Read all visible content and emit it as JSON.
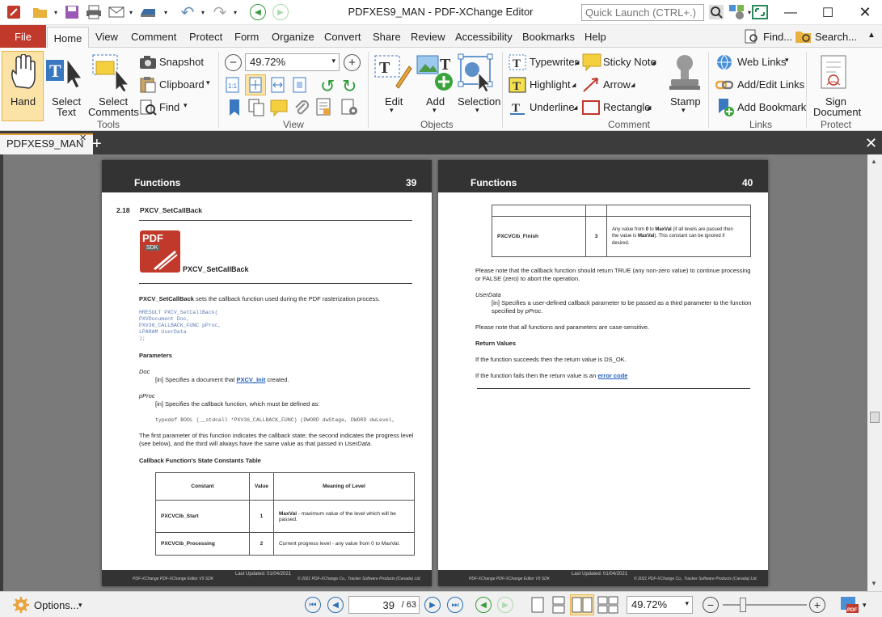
{
  "app": {
    "title": "PDFXES9_MAN - PDF-XChange Editor",
    "quick_launch_placeholder": "Quick Launch (CTRL+.)"
  },
  "menu": {
    "file": "File",
    "tabs": [
      "Home",
      "View",
      "Comment",
      "Protect",
      "Form",
      "Organize",
      "Convert",
      "Share",
      "Review",
      "Accessibility",
      "Bookmarks",
      "Help"
    ],
    "find": "Find...",
    "search": "Search..."
  },
  "ribbon": {
    "tools": {
      "hand": "Hand",
      "select_text": [
        "Select",
        "Text"
      ],
      "select_comments": [
        "Select",
        "Comments"
      ],
      "snapshot": "Snapshot",
      "clipboard": "Clipboard",
      "find": "Find",
      "group": "Tools"
    },
    "view": {
      "zoom": "49.72%",
      "group": "View"
    },
    "objects": {
      "edit": "Edit",
      "add": "Add",
      "selection": "Selection",
      "group": "Objects"
    },
    "comment": {
      "typewriter": "Typewriter",
      "sticky_note": "Sticky Note",
      "highlight": "Highlight",
      "arrow": "Arrow",
      "underline": "Underline",
      "rectangle": "Rectangle",
      "stamp": "Stamp",
      "group": "Comment"
    },
    "links": {
      "web_links": "Web Links",
      "add_edit_links": "Add/Edit Links",
      "add_bookmark": "Add Bookmark",
      "group": "Links"
    },
    "protect": {
      "sign_document": [
        "Sign",
        "Document"
      ],
      "group": "Protect"
    }
  },
  "doc_tab": {
    "name": "PDFXES9_MAN"
  },
  "page39": {
    "header": "Functions",
    "number": "39",
    "section": "2.18",
    "section_title": "PXCV_SetCallBack",
    "logo_text": "PDF",
    "logo_sub": "SDK",
    "heading": "PXCV_SetCallBack",
    "intro_bold": "PXCV_SetCallBack",
    "intro_rest": " sets the callback function used during the PDF rasterization process.",
    "code": [
      "HRESULT  PXCV_SetCallBack(",
      "     PXVDocument Doc,",
      "     PXV36_CALLBACK_FUNC pProc,",
      "     LPARAM UserData",
      ");"
    ],
    "params_heading": "Parameters",
    "p1_name": "Doc",
    "p1_desc_a": "[in] Specifies a document that ",
    "p1_link": "PXCV_Init",
    "p1_desc_b": " created.",
    "p2_name": "pProc",
    "p2_desc": "[in] Specifies the callback function, which must be defined as:",
    "typedef": "typedef BOOL (__stdcall *PXV36_CALLBACK_FUNC) (DWORD dwStage, DWORD dwLevel,",
    "para1": "The first parameter of this function indicates the callback state; the second indicates the progress level",
    "para2a": "(see below), and the third will always have the same value as that passed in ",
    "para2b": "UserData",
    "para2c": ".",
    "table_title": "Callback Function's State Constants Table",
    "table_headers": [
      "Constant",
      "Value",
      "Meaning of Level"
    ],
    "table_rows": [
      {
        "c": "PXCVClb_Start",
        "v": "1",
        "m_b": "MaxVal",
        "m": " - maximum value of the level which will be passed."
      },
      {
        "c": "PXCVClb_Processing",
        "v": "2",
        "m_b": "",
        "m": "Current progress level - any value from 0 to MaxVal."
      }
    ],
    "footer_left": "PDF-XChange PDF-XChange Editor V9 SDK",
    "footer_mid": "Last Updated: 01/04/2021",
    "footer_right": "© 2021 PDF-XChange Co., Tracker Software Products (Canada) Ltd."
  },
  "page40": {
    "header": "Functions",
    "number": "40",
    "row_const": "PXCVClb_Finish",
    "row_val": "3",
    "row_m1a": "Any value from ",
    "row_m1b": "0",
    "row_m1c": " to ",
    "row_m1d": "MaxVal",
    "row_m1e": " (if all levels are passed then",
    "row_m2a": "the value is ",
    "row_m2b": "MaxVal",
    "row_m2c": "). This constant can be ignored if",
    "row_m3": "desired.",
    "note1": "Please note that the callback function should return TRUE (any non-zero value) to continue processing",
    "note2": "or FALSE (zero) to abort the operation.",
    "ud_name": "UserData",
    "ud1": "[in] Specifies a user-defined callback parameter to be passed as a third parameter to the function",
    "ud2a": "specified by ",
    "ud2b": "pProc",
    "note3": "Please note that all functions and parameters are case-sensitive.",
    "rv_heading": "Return Values",
    "rv1": "If the function succeeds then the return value is DS_OK.",
    "rv2a": "If the function fails then the return value is an ",
    "rv2b": "error code",
    "footer_left": "PDF-XChange PDF-XChange Editor V9 SDK",
    "footer_mid": "Last Updated: 01/04/2021",
    "footer_right": "© 2021 PDF-XChange Co., Tracker Software Products (Canada) Ltd."
  },
  "status": {
    "options": "Options...",
    "page_current": "39",
    "page_total": "/ 63",
    "zoom": "49.72%"
  },
  "colors": {
    "accent": "#c0392b",
    "link": "#1f5fbf",
    "dark": "#333333"
  }
}
